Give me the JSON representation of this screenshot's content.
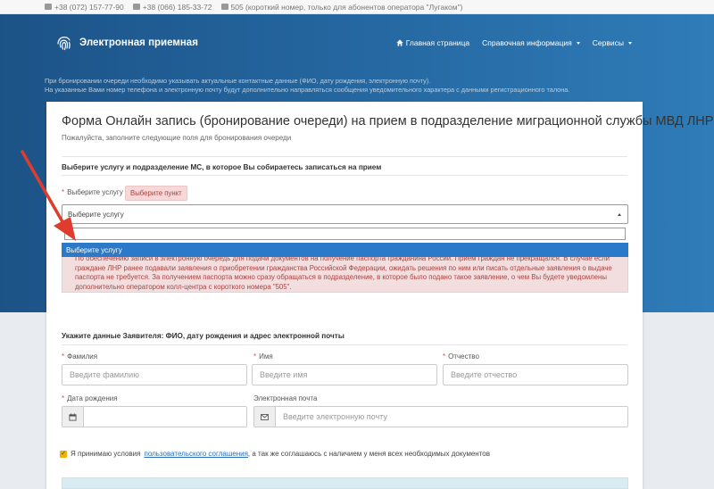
{
  "topbar": {
    "contacts": [
      {
        "icon": "phone-icon",
        "text": "+38 (072) 157-77-90"
      },
      {
        "icon": "phone-icon",
        "text": "+38 (066) 185-33-72"
      },
      {
        "icon": "phone-icon",
        "text": "505 (короткий номер, только для абонентов оператора \"Лугаком\")"
      }
    ]
  },
  "header": {
    "brand": "Электронная приемная",
    "nav": {
      "home": "Главная страница",
      "info": "Справочная информация",
      "services": "Сервисы"
    }
  },
  "hero_note": {
    "line1": "При бронировании очереди необходимо указывать актуальные контактные данные (ФИО, дату рождения, электронную почту).",
    "line2": "На указанные Вами номер телефона и электронную почту будут дополнительно направляться сообщения уведомительного характера с данными регистрационного талона."
  },
  "form": {
    "title": "Форма Онлайн запись (бронирование очереди) на прием в подразделение миграционной службы МВД ЛНР",
    "subtitle": "Пожалуйста, заполните следующие поля для бронирования очереди",
    "section1": "Выберите услугу и подразделение МС, в которое Вы собираетесь записаться на прием",
    "service_label": "Выберите услугу",
    "service_badge": "Выберите пункт",
    "service_select": "Выберите услугу",
    "dropdown_option": "Выберите услугу",
    "alert_lines": [
      "По обеспечению записи в электронную очередь для подачи документов на получение паспорта гражданина России. Прием граждан не прекращался. В случае если",
      "граждане ЛНР ранее подавали заявления о приобретении гражданства Российской Федерации, ожидать решения по ним или писать отдельные заявления о выдаче",
      "паспорта не требуется. За получением паспорта можно сразу обращаться в подразделение, в которое было подано такое заявление, о чем Вы будете уведомлены",
      "дополнительно оператором колл-центра с короткого номера \"505\"."
    ],
    "section2": "Укажите данные Заявителя: ФИО, дату рождения и адрес электронной почты",
    "surname_label": "Фамилия",
    "surname_placeholder": "Введите фамилию",
    "name_label": "Имя",
    "name_placeholder": "Введите имя",
    "patronymic_label": "Отчество",
    "patronymic_placeholder": "Введите отчество",
    "dob_label": "Дата рождения",
    "dob_value": "",
    "email_label": "Электронная почта",
    "email_placeholder": "Введите электронную почту",
    "agree_pre": "Я принимаю условия",
    "agree_link": "пользовательского соглашения",
    "agree_post": ", а так же соглашаюсь с наличием у меня всех необходимых документов"
  },
  "colors": {
    "hero": "#24659e",
    "alert_bg": "#f2dede",
    "alert_text": "#a94442",
    "selected_option": "#2b7ac9",
    "arrow": "#e03c2d"
  }
}
